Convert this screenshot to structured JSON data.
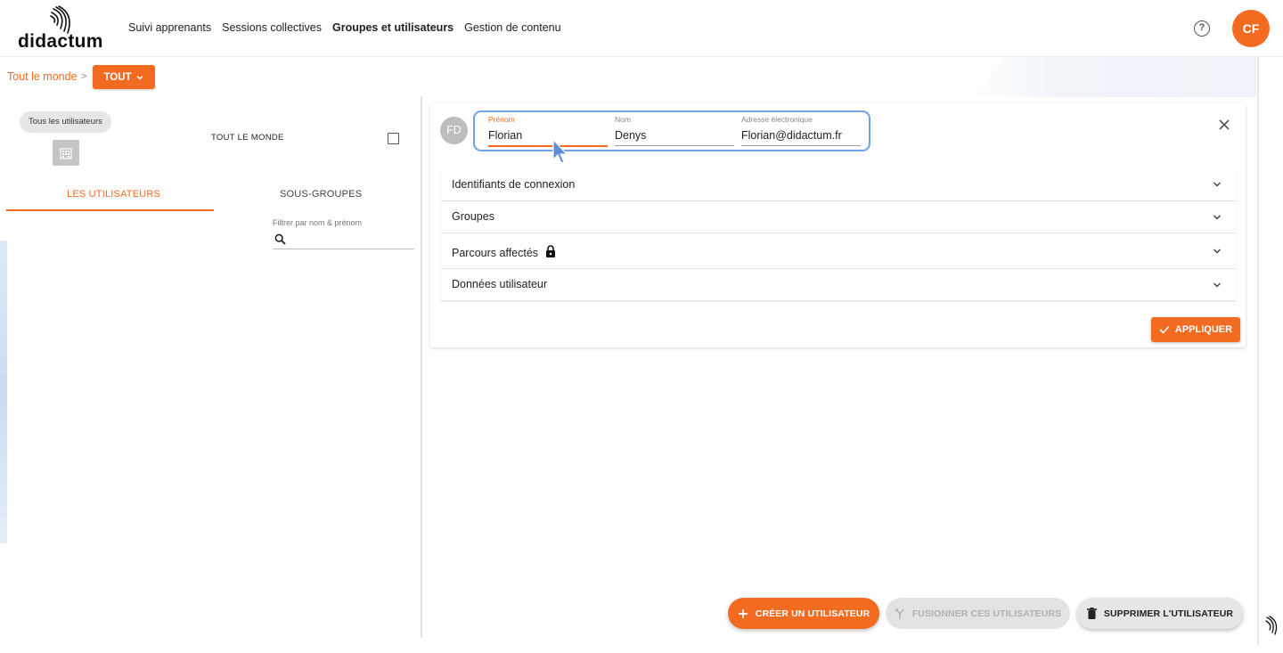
{
  "app": {
    "logo_text": "didactum",
    "nav": [
      {
        "label": "Suivi apprenants",
        "active": false
      },
      {
        "label": "Sessions collectives",
        "active": false
      },
      {
        "label": "Groupes et utilisateurs",
        "active": true
      },
      {
        "label": "Gestion de contenu",
        "active": false
      }
    ],
    "help_icon": "?",
    "user_initials": "CF",
    "accent_color": "#f36a21"
  },
  "breadcrumb": {
    "root": "Tout le monde",
    "separator": ">",
    "dropdown_label": "TOUT"
  },
  "left_panel": {
    "chip": "Tous les utilisateurs",
    "group_name": "TOUT LE MONDE",
    "tabs": [
      {
        "label": "LES UTILISATEURS",
        "active": true
      },
      {
        "label": "SOUS-GROUPES",
        "active": false
      }
    ],
    "filter_label": "Filtrer par nom & prénom",
    "filter_value": ""
  },
  "user_card": {
    "avatar_initials": "FD",
    "fields": [
      {
        "label": "Prénom",
        "value": "Florian",
        "active": true
      },
      {
        "label": "Nom",
        "value": "Denys",
        "active": false
      },
      {
        "label": "Adresse électronique",
        "value": "Florian@didactum.fr",
        "active": false
      }
    ],
    "sections": [
      {
        "label": "Identifiants de connexion",
        "locked": false
      },
      {
        "label": "Groupes",
        "locked": false
      },
      {
        "label": "Parcours affectés",
        "locked": true
      },
      {
        "label": "Données utilisateur",
        "locked": false
      }
    ],
    "apply_label": "APPLIQUER"
  },
  "actions": {
    "create": "CRÉER UN UTILISATEUR",
    "merge": "FUSIONNER CES UTILISATEURS",
    "delete": "SUPPRIMER L'UTILISATEUR"
  },
  "highlight_color": "#6fa3e8"
}
